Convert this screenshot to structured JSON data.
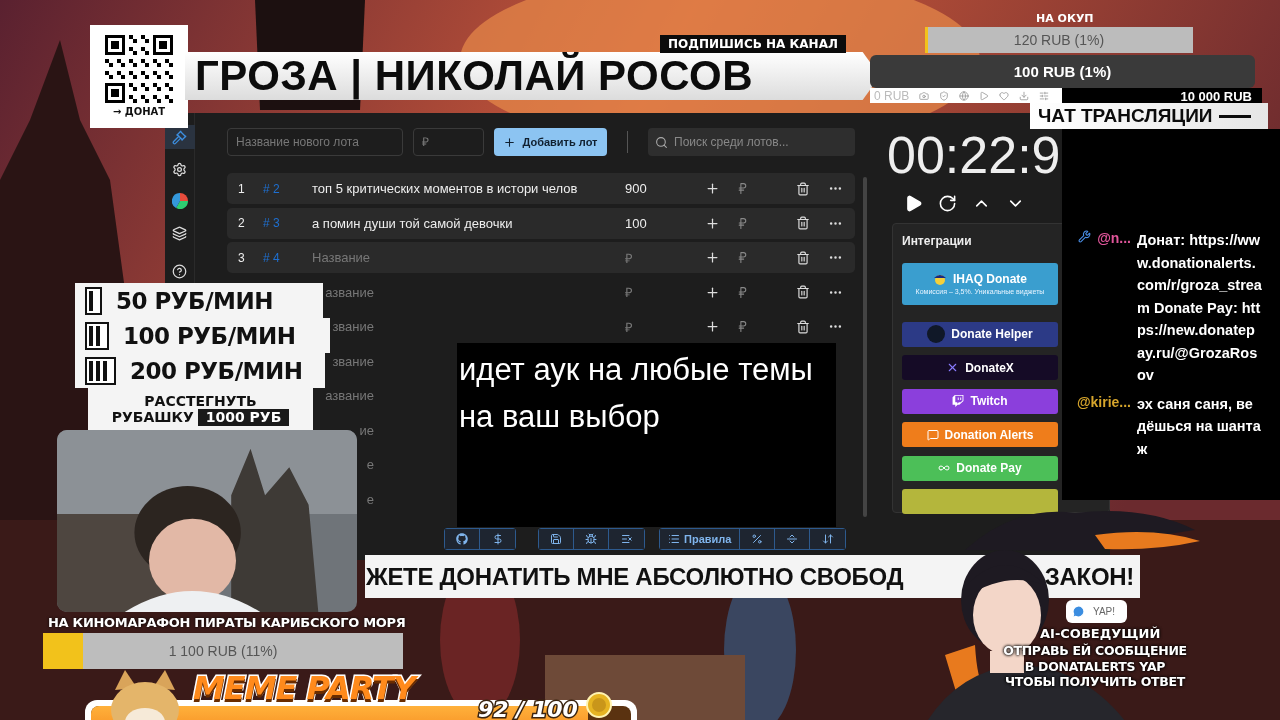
{
  "qr_card": {
    "caption": "→ ДОНАТ"
  },
  "title_banner": {
    "badge": "ПОДПИШИСЬ НА КАНАЛ",
    "title": "ГРОЗА | НИКОЛАЙ РОСОВ"
  },
  "goal_top": {
    "label": "НА ОКУП",
    "bar": {
      "text": "120 RUB (1%)",
      "level": 0.01
    },
    "second_bar": {
      "text": "100 RUB (1%)"
    }
  },
  "browser_strip": {
    "text": "0 RUB",
    "total": "10 000 RUB"
  },
  "chat_header": "ЧАТ ТРАНСЛЯЦИИ",
  "app": {
    "sidebar": [
      {
        "kind": "gavel",
        "selected": true
      },
      {
        "kind": "settings",
        "selected": false
      },
      {
        "kind": "chart",
        "selected": false
      },
      {
        "kind": "layers",
        "selected": false
      },
      {
        "kind": "help",
        "selected": false
      }
    ],
    "toolbar": {
      "name_placeholder": "Название нового лота",
      "price_placeholder": "₽",
      "add_button": "Добавить лот",
      "search_placeholder": "Поиск среди лотов..."
    },
    "lots": [
      {
        "kind": "filled",
        "num": "1",
        "tag": "# 2",
        "name": "топ 5 критических моментов в истори челов",
        "amount": "900"
      },
      {
        "kind": "filled",
        "num": "2",
        "tag": "# 3",
        "name": "а помин души той самой девочки",
        "amount": "100"
      },
      {
        "kind": "empty",
        "num": "3",
        "tag": "# 4",
        "name_placeholder": "Название",
        "amount_placeholder": "₽"
      },
      {
        "kind": "cut",
        "name_fragment": "азвание",
        "amount_placeholder": "₽"
      },
      {
        "kind": "cut",
        "name_fragment": "звание",
        "amount_placeholder": "₽"
      },
      {
        "kind": "hidden",
        "name_fragment": "звание"
      },
      {
        "kind": "hidden",
        "name_fragment": "азвание"
      },
      {
        "kind": "hidden",
        "name_fragment": "ие"
      },
      {
        "kind": "hidden",
        "name_fragment": "е"
      },
      {
        "kind": "hidden",
        "name_fragment": "е"
      }
    ],
    "timer": "00:22:9",
    "integrations": {
      "title": "Интеграции",
      "buttons": [
        {
          "kind": "ihaq",
          "label": "IHAQ Donate",
          "note": "Комиссия – 3,5%. Уникальные виджеты",
          "color": "#3a9ecf"
        },
        {
          "kind": "helper",
          "label": "Donate Helper",
          "color": "#2c3a86"
        },
        {
          "kind": "donatex",
          "label": "DonateX",
          "color": "#150b26"
        },
        {
          "kind": "twitch",
          "label": "Twitch",
          "color": "#8b3fdc"
        },
        {
          "kind": "alerts",
          "label": "Donation Alerts",
          "color": "#ef7d1b"
        },
        {
          "kind": "pay",
          "label": "Donate Pay",
          "color": "#4cbf58"
        },
        {
          "kind": "covered",
          "color": "#b4b63c"
        }
      ]
    },
    "bottom_toolbar": [
      [
        {
          "kind": "github"
        },
        {
          "kind": "dollar"
        }
      ],
      [
        {
          "kind": "save"
        },
        {
          "kind": "bug"
        },
        {
          "kind": "clear"
        }
      ],
      [
        {
          "kind": "rules",
          "label": "Правила"
        },
        {
          "kind": "percent"
        },
        {
          "kind": "split"
        },
        {
          "kind": "sort"
        }
      ]
    ]
  },
  "chat": {
    "messages": [
      {
        "user": "@n...",
        "color": "#e0559a",
        "badge": true,
        "text": "Донат: https://www.donationalerts.com/r/groza_stream Donate Pay: https://new.donatepay.ru/@GrozaRosov"
      },
      {
        "user": "@kirie...",
        "color": "#d6a52c",
        "badge": false,
        "text": "эх саня саня, ведёшься на шантаж"
      }
    ]
  },
  "price_list": {
    "tiers": [
      {
        "kind": "one",
        "price": "50 РУБ/МИН"
      },
      {
        "kind": "two",
        "price": "100 РУБ/МИН"
      },
      {
        "kind": "three",
        "price": "200 РУБ/МИН"
      }
    ],
    "extra": {
      "line1": "РАССТЕГНУТЬ",
      "line2": "РУБАШКУ",
      "price": "1000 РУБ"
    }
  },
  "goal_bottom": {
    "label": "НА КИНОМАРАФОН ПИРАТЫ КАРИБСКОГО МОРЯ",
    "text": "1 100 RUB (11%)",
    "level": 0.11
  },
  "meme_party": {
    "title": "MEME PARTY",
    "count": "92 / 100",
    "level": 0.92
  },
  "subtitle": "идет аук на любые темы на ваш выбор",
  "ticker": {
    "text": "ЖЕТЕ ДОНАТИТЬ МНЕ АБСОЛЮТНО СВОБОД",
    "tail": "ЗАКОН!"
  },
  "ai_host": {
    "badge": "YAP!",
    "title": "AI-СОВЕДУЩИЙ",
    "message": "ОТПРАВЬ ЕЙ СООБЩЕНИЕ В DONATALERTS  YAP ЧТОБЫ ПОЛУЧИТЬ ОТВЕТ"
  }
}
